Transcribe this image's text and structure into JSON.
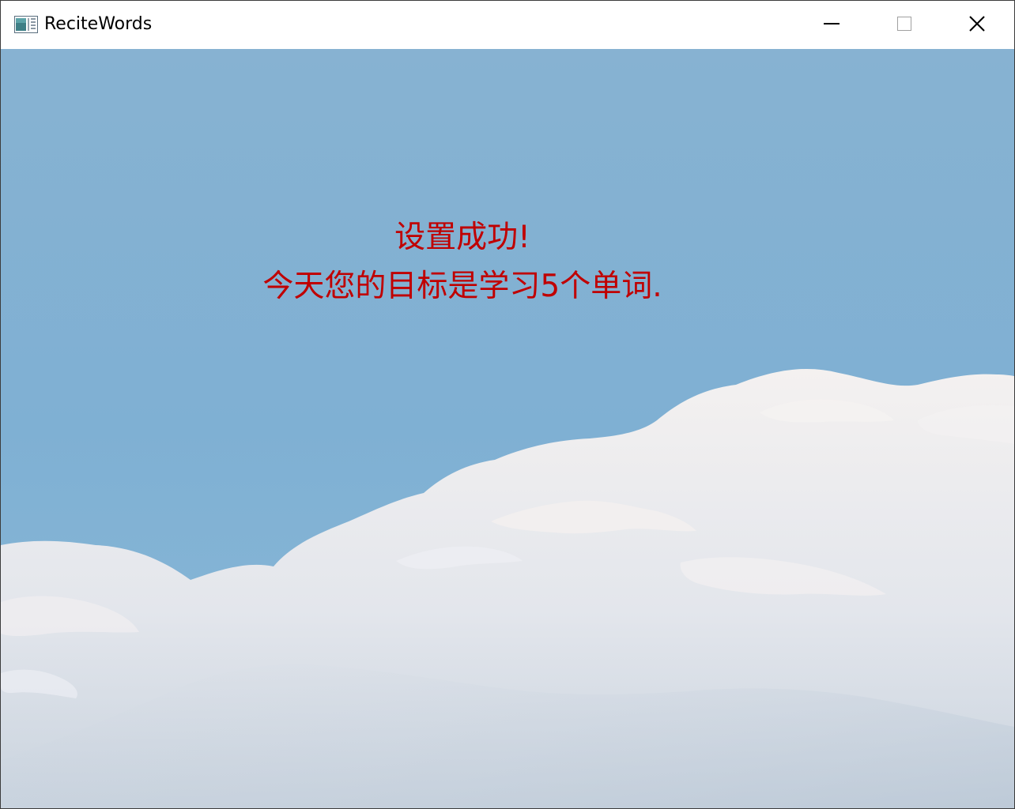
{
  "window": {
    "title": "ReciteWords",
    "controls": {
      "minimize_icon": "minimize-icon",
      "maximize_icon": "maximize-icon",
      "close_icon": "close-icon"
    }
  },
  "main": {
    "success_line": "设置成功!",
    "goal_line": "今天您的目标是学习5个单词."
  },
  "colors": {
    "message_text": "#c00000",
    "sky_top": "#86b3d3",
    "sky_mid": "#7fb0d2",
    "cloud": "#eef0f4"
  }
}
